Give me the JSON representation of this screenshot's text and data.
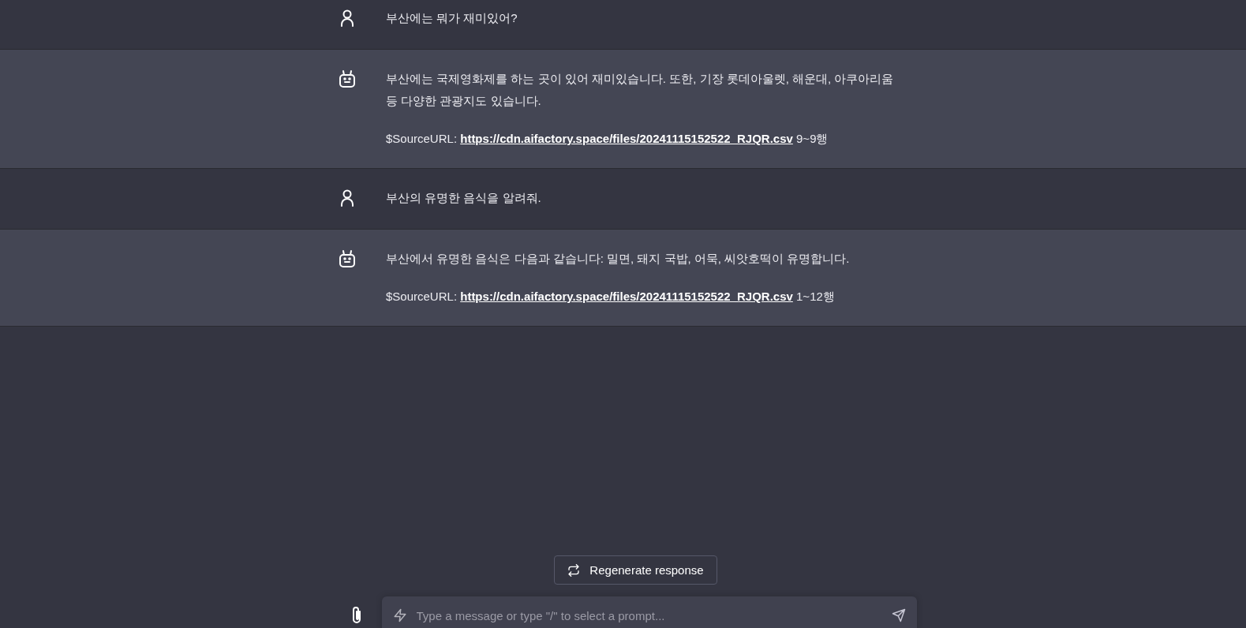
{
  "messages": [
    {
      "kind": "user",
      "paragraphs": [
        "부산에는 뭐가 재미있어?"
      ]
    },
    {
      "kind": "bot",
      "paragraphs": [
        "부산에는 국제영화제를 하는 곳이 있어 재미있습니다. 또한, 기장 롯데아울렛, 해운대, 아쿠아리움 등 다양한 관광지도 있습니다."
      ],
      "source": {
        "label": "$SourceURL:",
        "url": "https://cdn.aifactory.space/files/20241115152522_RJQR.csv",
        "rows": "9~9행"
      }
    },
    {
      "kind": "user",
      "paragraphs": [
        "부산의 유명한 음식을 알려줘."
      ]
    },
    {
      "kind": "bot",
      "paragraphs": [
        "부산에서 유명한 음식은 다음과 같습니다: 밀면, 돼지 국밥, 어묵, 씨앗호떡이 유명합니다."
      ],
      "source": {
        "label": "$SourceURL:",
        "url": "https://cdn.aifactory.space/files/20241115152522_RJQR.csv",
        "rows": "1~12행"
      }
    }
  ],
  "regenerate_button": {
    "label": "Regenerate response"
  },
  "composer": {
    "placeholder": "Type a message or type \"/\" to select a prompt..."
  }
}
